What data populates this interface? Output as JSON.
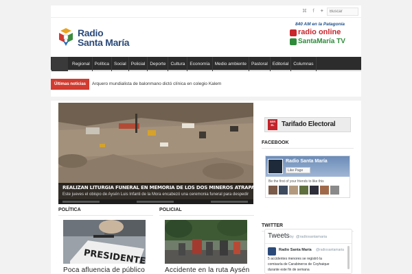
{
  "topbar": {
    "social_icons": [
      "rss-icon",
      "facebook-icon",
      "twitter-icon",
      "youtube-icon"
    ],
    "social_glyphs": "⌘ f ✦ ▶",
    "search_placeholder": "Buscar"
  },
  "logo": {
    "line1": "Radio",
    "line2": "Santa María"
  },
  "promo": {
    "line1": "840 AM en la Patagonia",
    "line2": "radio online",
    "line3": "SantaMaría TV"
  },
  "nav": {
    "items": [
      "Regional",
      "Política",
      "Social",
      "Policial",
      "Deporte",
      "Cultura",
      "Economía",
      "Medio ambiente",
      "Pastoral",
      "Editorial",
      "Columnas"
    ]
  },
  "breaking": {
    "tag": "Últimas noticias",
    "text": "Arquero mundialista de balonmano dictó clínica en colegio Kalem"
  },
  "slider": {
    "title": "REALIZAN LITURGIA FUNERAL EN MEMORIA DE LOS DOS MINEROS ATRAPADOS EN CHILE CHICO",
    "summary": "Este jueves el obispo de Aysén Luis Infanti de la Mora encabezó una ceremonia funeral para despedir"
  },
  "sections": {
    "politica": {
      "title": "POLÍTICA",
      "headline": "Poca afluencia de público",
      "thumb_text": "PRESIDENTE"
    },
    "policial": {
      "title": "POLICIAL",
      "headline": "Accidente en la ruta Aysén"
    }
  },
  "sidebar": {
    "banner": {
      "badge": "SER EL",
      "text": "Tarifado Electoral"
    },
    "facebook": {
      "title": "FACEBOOK",
      "page_name": "Radio Santa María",
      "like_label": "Like Page",
      "friends_text": "Be the first of your friends to like this"
    },
    "twitter": {
      "title": "TWITTER",
      "header": "Tweets",
      "by": "by",
      "handle": "@radiosantamaria",
      "author": "Radio Santa María",
      "author_handle": "@radiosantamaria",
      "tweet_lines": [
        "5 accidentes menores se registró la",
        "comisaría de Carabineros de Coyhaique",
        "durante este fin de semana"
      ]
    }
  },
  "colors": {
    "accent": "#d23b2f",
    "nav_bg": "#2c2c2c",
    "brand_blue": "#2b4a7a"
  }
}
